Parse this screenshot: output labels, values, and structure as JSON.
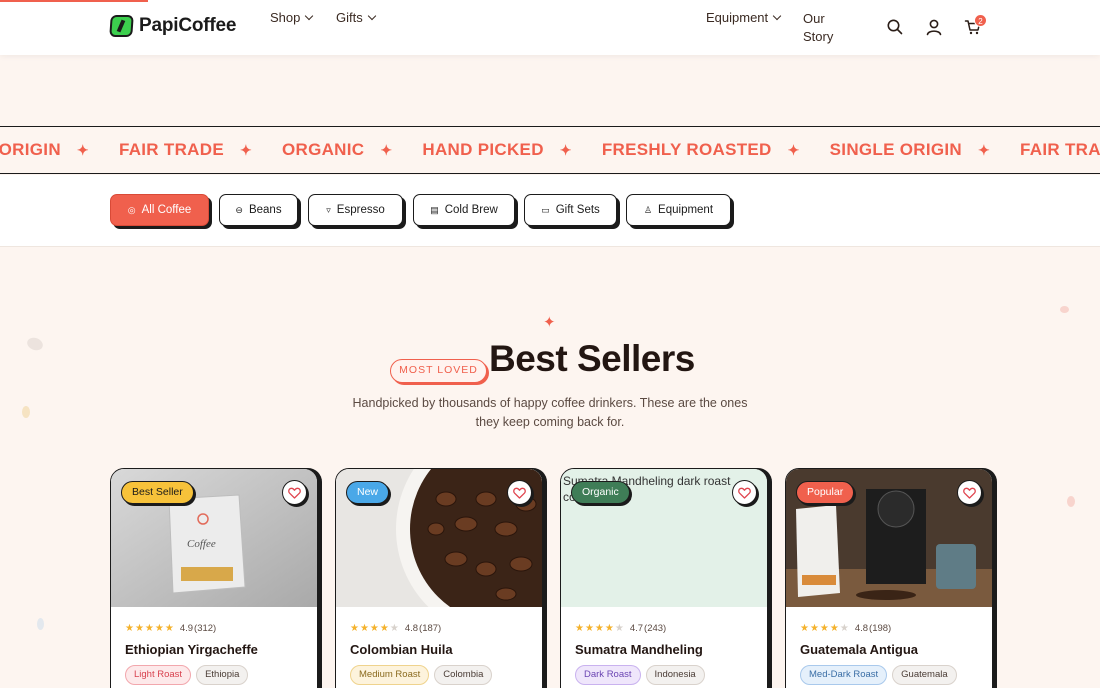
{
  "header": {
    "brand": "PapiCoffee",
    "nav": [
      {
        "label": "Shop",
        "has_dropdown": true
      },
      {
        "label": "Gifts",
        "has_dropdown": true
      },
      {
        "label": "Equipment",
        "has_dropdown": true
      },
      {
        "label": "Our Story",
        "has_dropdown": false
      }
    ],
    "icons": [
      "search-icon",
      "user-icon",
      "cart-icon"
    ],
    "cart_count": "2"
  },
  "marquee": {
    "items": [
      "E ORIGIN",
      "FAIR TRADE",
      "ORGANIC",
      "HAND PICKED",
      "FRESHLY ROASTED",
      "SINGLE ORIGIN",
      "FAIR TRADE"
    ],
    "separator": "✦"
  },
  "filters": [
    {
      "label": "All Coffee",
      "icon": "target-icon",
      "active": true
    },
    {
      "label": "Beans",
      "icon": "bean-icon",
      "active": false
    },
    {
      "label": "Espresso",
      "icon": "cup-icon",
      "active": false
    },
    {
      "label": "Cold Brew",
      "icon": "jar-icon",
      "active": false
    },
    {
      "label": "Gift Sets",
      "icon": "gift-icon",
      "active": false
    },
    {
      "label": "Equipment",
      "icon": "kettle-icon",
      "active": false
    }
  ],
  "section": {
    "pill": "MOST LOVED",
    "title": "Best Sellers",
    "subtitle": "Handpicked by thousands of happy coffee drinkers. These are the ones they keep coming back for."
  },
  "products": [
    {
      "badge": "Best Seller",
      "badge_color": "#f7c23a",
      "badge_text": "#1b1b1b",
      "rating": "4.9",
      "reviews": "(312)",
      "stars": 5,
      "name": "Ethiopian Yirgacheffe",
      "roast": "Light Roast",
      "roast_style": "light",
      "origin": "Ethiopia"
    },
    {
      "badge": "New",
      "badge_color": "#4aa8e8",
      "badge_text": "#ffffff",
      "rating": "4.8",
      "reviews": "(187)",
      "stars": 4,
      "name": "Colombian Huila",
      "roast": "Medium Roast",
      "roast_style": "medium",
      "origin": "Colombia"
    },
    {
      "badge": "Organic",
      "badge_color": "#3f7d57",
      "badge_text": "#ffffff",
      "rating": "4.7",
      "reviews": "(243)",
      "stars": 4,
      "name": "Sumatra Mandheling",
      "roast": "Dark Roast",
      "roast_style": "dark",
      "origin": "Indonesia",
      "image_alt": "Sumatra Mandheling dark roast coffee beans"
    },
    {
      "badge": "Popular",
      "badge_color": "#f0604d",
      "badge_text": "#ffffff",
      "rating": "4.8",
      "reviews": "(198)",
      "stars": 4,
      "name": "Guatemala Antigua",
      "roast": "Med-Dark Roast",
      "roast_style": "meddark",
      "origin": "Guatemala"
    }
  ],
  "colors": {
    "accent": "#f0604d",
    "background": "#fdf5f0",
    "ink": "#1b1b1b"
  }
}
